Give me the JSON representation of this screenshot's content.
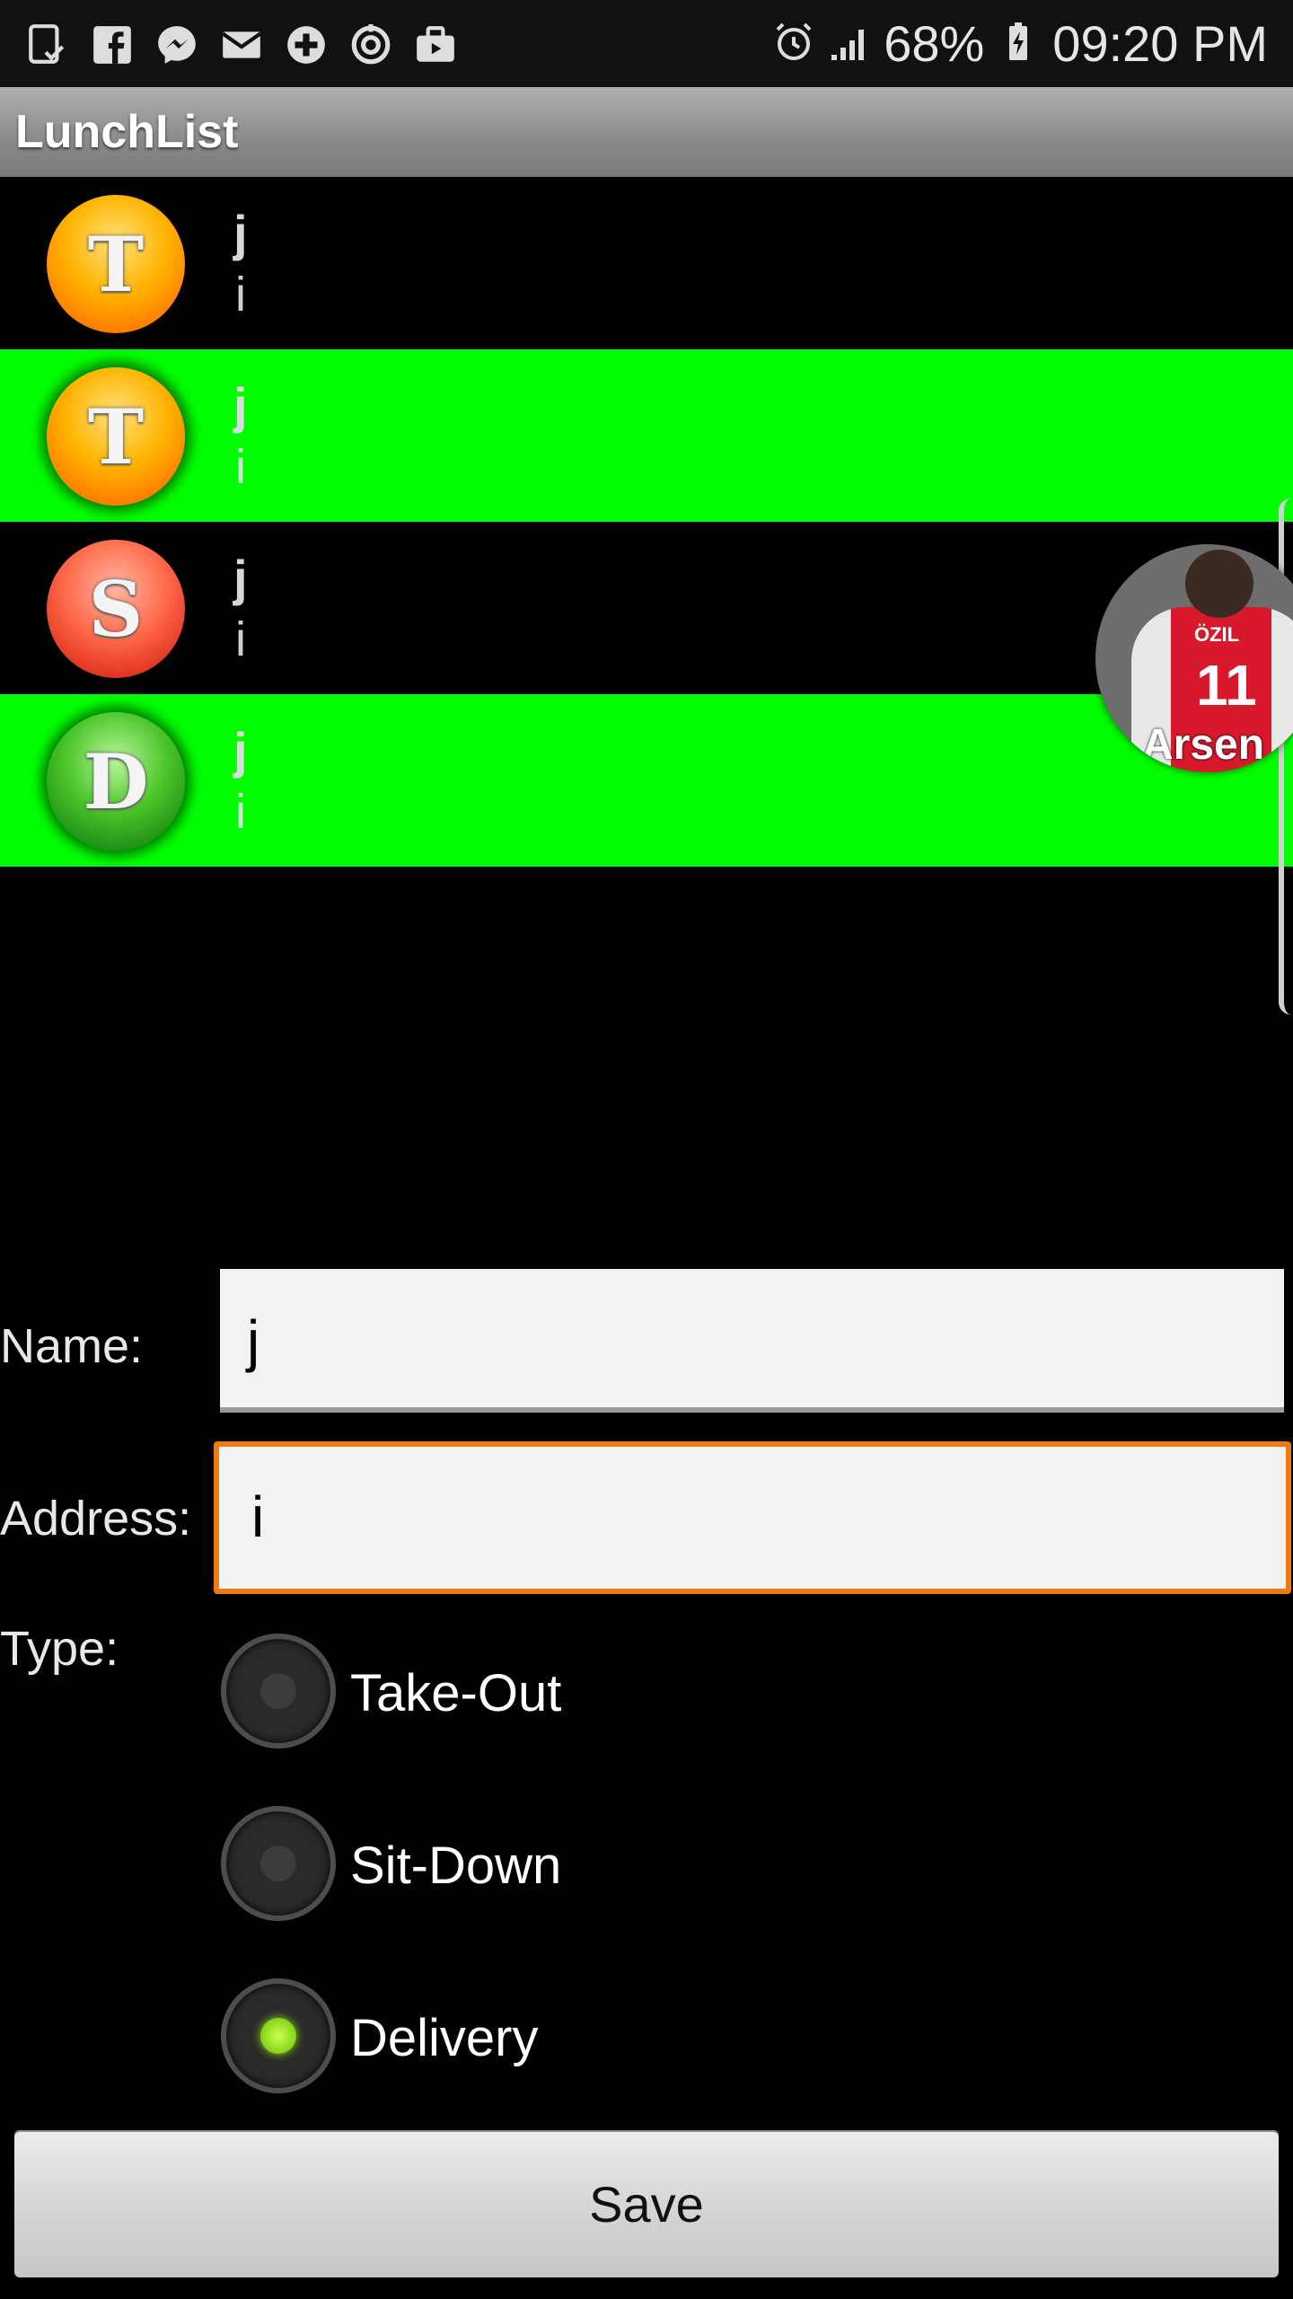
{
  "status_bar": {
    "icons_left": [
      "tablet-check-icon",
      "facebook-icon",
      "messenger-icon",
      "mail-icon",
      "plus-circle-icon",
      "sync-circle-icon",
      "briefcase-icon"
    ],
    "icons_right": [
      "alarm-icon",
      "signal-icon",
      "battery-charging-icon"
    ],
    "battery": "68%",
    "time": "09:20 PM"
  },
  "action_bar": {
    "title": "LunchList"
  },
  "restaurants": [
    {
      "icon_letter": "T",
      "icon": "take-out-icon",
      "name": "j",
      "address": "i",
      "bg": "#000000"
    },
    {
      "icon_letter": "T",
      "icon": "take-out-icon",
      "name": "j",
      "address": "i",
      "bg": "#00ff00"
    },
    {
      "icon_letter": "S",
      "icon": "sit-down-icon",
      "name": "j",
      "address": "i",
      "bg": "#000000"
    },
    {
      "icon_letter": "D",
      "icon": "delivery-icon",
      "name": "j",
      "address": "i",
      "bg": "#00ff00"
    }
  ],
  "chat_head": {
    "shirt_name": "ÖZIL",
    "number": "11",
    "brand": "Arsen"
  },
  "form": {
    "name_label": "Name:",
    "name_value": "j",
    "address_label": "Address:",
    "address_value": "i",
    "type_label": "Type:",
    "types": [
      {
        "label": "Take-Out",
        "checked": false
      },
      {
        "label": "Sit-Down",
        "checked": false
      },
      {
        "label": "Delivery",
        "checked": true
      }
    ],
    "save_label": "Save"
  },
  "colors": {
    "highlight_row": "#00ff00",
    "focus_border": "#f07a10",
    "radio_selected": "#86d318"
  }
}
